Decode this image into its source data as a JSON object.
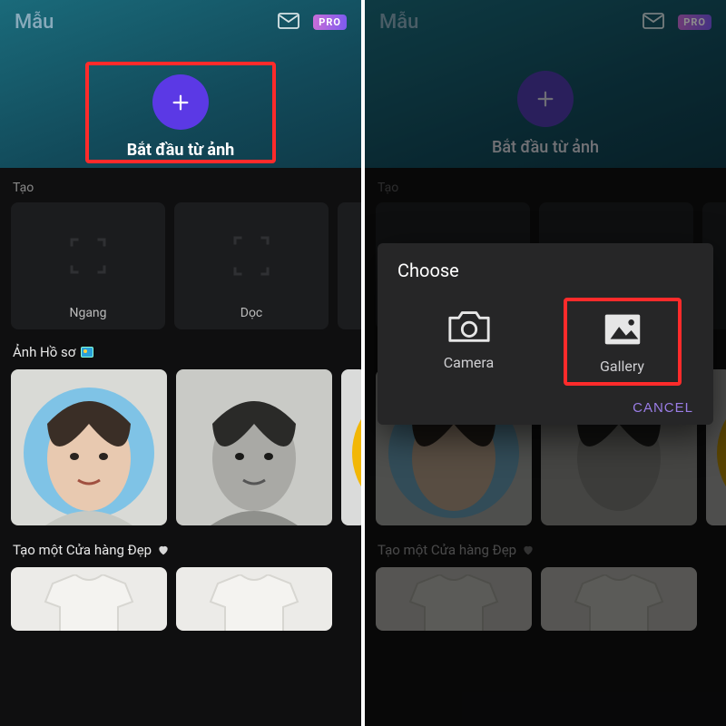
{
  "app": {
    "title": "Mẫu",
    "pro_badge": "PRO"
  },
  "start": {
    "label": "Bắt đầu từ ảnh"
  },
  "create": {
    "section": "Tạo",
    "items": [
      "Ngang",
      "Dọc"
    ]
  },
  "profile": {
    "section": "Ảnh Hồ sơ"
  },
  "shop": {
    "section": "Tạo một Cửa hàng Đẹp"
  },
  "dialog": {
    "title": "Choose",
    "camera": "Camera",
    "gallery": "Gallery",
    "cancel": "CANCEL"
  },
  "colors": {
    "accent": "#5b39e5",
    "highlight": "#ff2b2b",
    "cancel": "#9a7de6"
  }
}
